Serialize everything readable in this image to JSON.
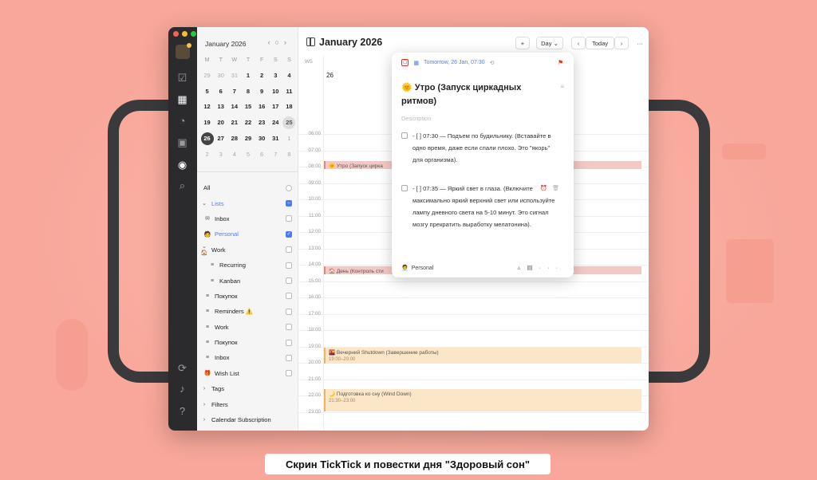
{
  "caption": "Скрин TickTick и повестки дня \"Здоровый сон\"",
  "sidebar": {
    "month": "January 2026",
    "weekday_labels": [
      "M",
      "T",
      "W",
      "T",
      "F",
      "S",
      "S"
    ],
    "weeks": [
      [
        "29",
        "30",
        "31",
        "1",
        "2",
        "3",
        "4"
      ],
      [
        "5",
        "6",
        "7",
        "8",
        "9",
        "10",
        "11"
      ],
      [
        "12",
        "13",
        "14",
        "15",
        "16",
        "17",
        "18"
      ],
      [
        "19",
        "20",
        "21",
        "22",
        "23",
        "24",
        "25"
      ],
      [
        "26",
        "27",
        "28",
        "29",
        "30",
        "31",
        "1"
      ],
      [
        "2",
        "3",
        "4",
        "5",
        "6",
        "7",
        "8"
      ]
    ],
    "items": [
      {
        "label": "All"
      },
      {
        "label": "Lists"
      },
      {
        "label": "Inbox"
      },
      {
        "label": "Personal"
      },
      {
        "label": "Work"
      },
      {
        "label": "Recurring"
      },
      {
        "label": "Kanban"
      },
      {
        "label": "Покупок"
      },
      {
        "label": "Reminders ⚠️"
      },
      {
        "label": "Work"
      },
      {
        "label": "Покупок"
      },
      {
        "label": "Inbox"
      },
      {
        "label": "Wish List"
      },
      {
        "label": "Tags"
      },
      {
        "label": "Filters"
      },
      {
        "label": "Calendar Subscription"
      }
    ]
  },
  "header": {
    "title": "January 2026",
    "add_label": "+",
    "view_label": "Day",
    "prev_label": "‹",
    "today_label": "Today",
    "next_label": "›",
    "more_label": "···",
    "week_label": "W5",
    "day_number": "26"
  },
  "hours": [
    "06:00",
    "07:00",
    "08:00",
    "09:00",
    "10:00",
    "11:00",
    "12:00",
    "13:00",
    "14:00",
    "15:00",
    "16:00",
    "17:00",
    "18:00",
    "19:00",
    "20:00",
    "21:00",
    "22:00",
    "23:00"
  ],
  "events": [
    {
      "title": "🌞 Утро (Запуск цирка",
      "time": ""
    },
    {
      "title": "🏠 День (Контроль сти",
      "time": ""
    },
    {
      "title": "🌇 Вечерний Shutdown (Завершение работы)",
      "time": "19:00–20:00"
    },
    {
      "title": "🌙 Подготовка ко сну (Wind Down)",
      "time": "21:30–23:00"
    }
  ],
  "popup": {
    "date": "Tomorrow, 26 Jan, 07:30",
    "title": "🌞 Утро (Запуск циркадных ритмов)",
    "description_placeholder": "Description",
    "items": [
      "- [ ] 07:30 — Подъем по будильнику. (Вставайте в одно время, даже если спали плохо. Это \"якорь\" для организма).",
      "- [ ] 07:35 — Яркий свет в глаза. (Включите максимально яркий верхний свет или используйте лампу дневного света на 5-10 минут. Это сигнал мозгу прекратить выработку мелатонина)."
    ],
    "list_name": "Personal"
  },
  "colors": {
    "accent": "#4c7bf0",
    "event_red": "#f3c9c6",
    "event_amber": "#fbe6c7",
    "background": "#f8a79a"
  }
}
